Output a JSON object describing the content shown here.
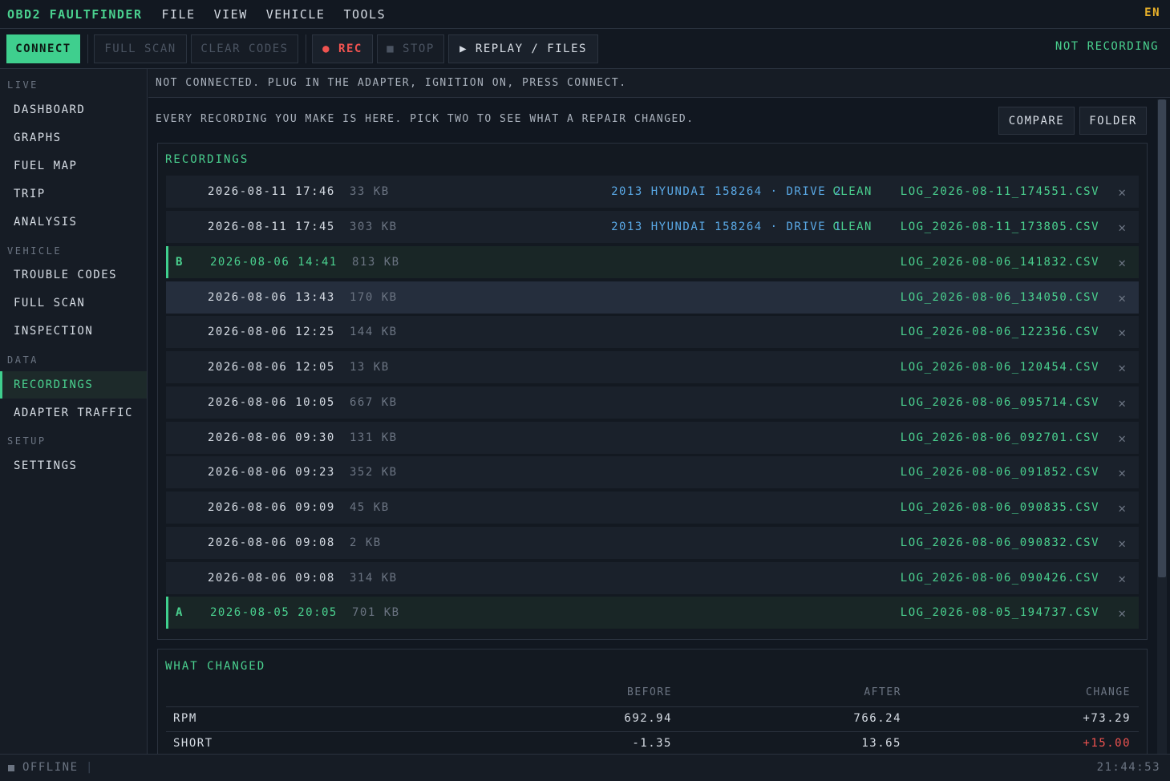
{
  "app": {
    "title": "OBD2 FAULTFINDER",
    "lang": "EN"
  },
  "menu": [
    "FILE",
    "VIEW",
    "VEHICLE",
    "TOOLS"
  ],
  "toolbar": {
    "connect": "CONNECT",
    "full_scan": "FULL SCAN",
    "clear_codes": "CLEAR CODES",
    "rec": "● REC",
    "stop": "■ STOP",
    "replay": "▶ REPLAY / FILES",
    "recording_status": "NOT RECORDING"
  },
  "sidebar": {
    "sections": [
      {
        "label": "LIVE",
        "items": [
          "DASHBOARD",
          "GRAPHS",
          "FUEL MAP",
          "TRIP",
          "ANALYSIS"
        ]
      },
      {
        "label": "VEHICLE",
        "items": [
          "TROUBLE CODES",
          "FULL SCAN",
          "INSPECTION"
        ]
      },
      {
        "label": "DATA",
        "items": [
          "RECORDINGS",
          "ADAPTER TRAFFIC"
        ]
      },
      {
        "label": "SETUP",
        "items": [
          "SETTINGS"
        ]
      }
    ],
    "active": "RECORDINGS"
  },
  "status_line": "NOT CONNECTED. PLUG IN THE ADAPTER, IGNITION ON, PRESS CONNECT.",
  "intro": "EVERY RECORDING YOU MAKE IS HERE. PICK TWO TO SEE WHAT A REPAIR CHANGED.",
  "actions": {
    "compare": "COMPARE",
    "folder": "FOLDER"
  },
  "recordings": {
    "title": "RECORDINGS",
    "rows": [
      {
        "mark": "",
        "date": "2026-08-11 17:46",
        "size": "33 KB",
        "vehicle": "2013 HYUNDAI 158264 · DRIVE 2",
        "tag": "CLEAN",
        "file": "LOG_2026-08-11_174551.CSV"
      },
      {
        "mark": "",
        "date": "2026-08-11 17:45",
        "size": "303 KB",
        "vehicle": "2013 HYUNDAI 158264 · DRIVE 1",
        "tag": "CLEAN",
        "file": "LOG_2026-08-11_173805.CSV"
      },
      {
        "mark": "B",
        "date": "2026-08-06 14:41",
        "size": "813 KB",
        "vehicle": "",
        "tag": "",
        "file": "LOG_2026-08-06_141832.CSV"
      },
      {
        "mark": "",
        "date": "2026-08-06 13:43",
        "size": "170 KB",
        "vehicle": "",
        "tag": "",
        "file": "LOG_2026-08-06_134050.CSV"
      },
      {
        "mark": "",
        "date": "2026-08-06 12:25",
        "size": "144 KB",
        "vehicle": "",
        "tag": "",
        "file": "LOG_2026-08-06_122356.CSV"
      },
      {
        "mark": "",
        "date": "2026-08-06 12:05",
        "size": "13 KB",
        "vehicle": "",
        "tag": "",
        "file": "LOG_2026-08-06_120454.CSV"
      },
      {
        "mark": "",
        "date": "2026-08-06 10:05",
        "size": "667 KB",
        "vehicle": "",
        "tag": "",
        "file": "LOG_2026-08-06_095714.CSV"
      },
      {
        "mark": "",
        "date": "2026-08-06 09:30",
        "size": "131 KB",
        "vehicle": "",
        "tag": "",
        "file": "LOG_2026-08-06_092701.CSV"
      },
      {
        "mark": "",
        "date": "2026-08-06 09:23",
        "size": "352 KB",
        "vehicle": "",
        "tag": "",
        "file": "LOG_2026-08-06_091852.CSV"
      },
      {
        "mark": "",
        "date": "2026-08-06 09:09",
        "size": "45 KB",
        "vehicle": "",
        "tag": "",
        "file": "LOG_2026-08-06_090835.CSV"
      },
      {
        "mark": "",
        "date": "2026-08-06 09:08",
        "size": "2 KB",
        "vehicle": "",
        "tag": "",
        "file": "LOG_2026-08-06_090832.CSV"
      },
      {
        "mark": "",
        "date": "2026-08-06 09:08",
        "size": "314 KB",
        "vehicle": "",
        "tag": "",
        "file": "LOG_2026-08-06_090426.CSV"
      },
      {
        "mark": "A",
        "date": "2026-08-05 20:05",
        "size": "701 KB",
        "vehicle": "",
        "tag": "",
        "file": "LOG_2026-08-05_194737.CSV"
      }
    ],
    "delete_glyph": "✕"
  },
  "what_changed": {
    "title": "WHAT CHANGED",
    "headers": {
      "before": "BEFORE",
      "after": "AFTER",
      "change": "CHANGE"
    },
    "rows": [
      {
        "name": "RPM",
        "before": "692.94",
        "after": "766.24",
        "change": "+73.29",
        "alert": false
      },
      {
        "name": "SHORT",
        "before": "-1.35",
        "after": "13.65",
        "change": "+15.00",
        "alert": true
      }
    ]
  },
  "footer": {
    "status": "OFFLINE",
    "separator": "|",
    "clock": "21:44:53"
  },
  "colors": {
    "accent": "#3fcf8e",
    "link": "#5aa9e6",
    "alert": "#ef5350",
    "lang": "#e8b12a"
  }
}
